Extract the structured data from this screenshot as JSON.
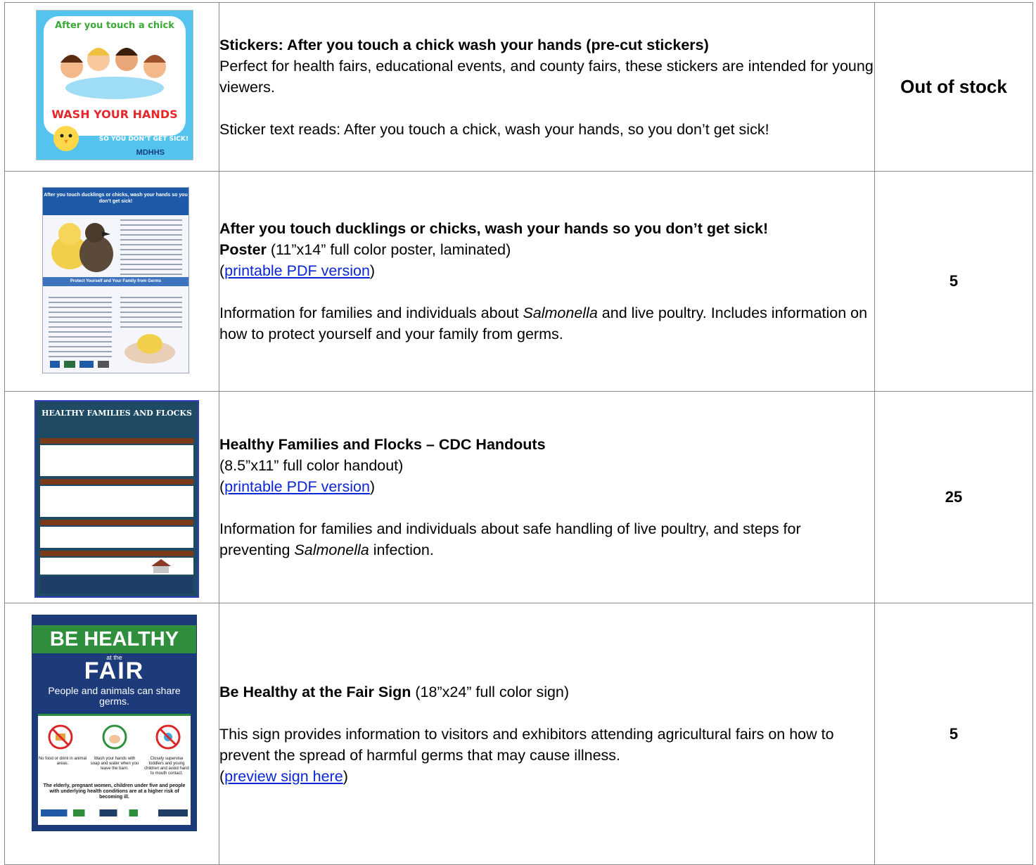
{
  "rows": [
    {
      "title": "Stickers: After you touch a chick wash your hands  (pre-cut stickers)",
      "desc1": "Perfect for health fairs, educational events, and county fairs, these stickers are intended for young viewers.",
      "desc2": "Sticker text reads: After you touch a chick, wash your hands, so you don’t get sick!",
      "qty": "Out of stock",
      "img": {
        "line1": "After you touch a chick",
        "line2": "WASH YOUR HANDS",
        "line3": "SO YOU DON’T GET SICK!",
        "logo": "MDHHS"
      }
    },
    {
      "title": "After you touch ducklings or chicks, wash your hands so you don’t get sick!",
      "title2": "Poster",
      "title2_rest": " (11”x14” full color poster, laminated)",
      "link_open": "(",
      "link": "printable PDF version",
      "link_close": ")",
      "desc_a": "Information for families and individuals about ",
      "desc_em": "Salmonella",
      "desc_b": " and live poultry. Includes information on how to protect yourself and your family from germs.",
      "qty": "5",
      "img": {
        "header": "After you touch ducklings or chicks, wash your hands so you don’t get sick!",
        "bar": "Protect Yourself and Your Family from Germs"
      }
    },
    {
      "title": "Healthy Families and Flocks – CDC Handouts",
      "sub": "(8.5”x11” full color handout)",
      "link_open": "(",
      "link": "printable PDF version",
      "link_close": ")",
      "desc_a": "Information for families and individuals about safe handling of live poultry, and steps for preventing ",
      "desc_em": "Salmonella",
      "desc_b": " infection.",
      "qty": "25",
      "img": {
        "title": "HEALTHY FAMILIES AND FLOCKS"
      }
    },
    {
      "title": "Be Healthy at the Fair Sign",
      "title_rest": " (18”x24” full color sign)",
      "desc": "This sign provides information to visitors and exhibitors attending agricultural fairs on how to prevent the spread of harmful germs that may cause illness.",
      "link_open": "(",
      "link": "preview sign here",
      "link_close": ")",
      "qty": "5",
      "img": {
        "band": "BE HEALTHY",
        "at": "at the",
        "fair": "FAIR",
        "sub": "People and animals can share germs.",
        "cap1": "No food or drink in animal areas.",
        "cap2": "Wash your hands with soap and water when you leave the barn.",
        "cap3": "Closely supervise toddlers and young children and avoid hand to mouth contact.",
        "note": "The elderly, pregnant women, children under five and people with underlying health conditions are at a higher risk of becoming ill."
      }
    }
  ],
  "colors": {
    "link": "#0b26d6",
    "border": "#8a8a8a",
    "fair_green": "#2f8f3d",
    "fair_blue": "#1d3a7a"
  }
}
